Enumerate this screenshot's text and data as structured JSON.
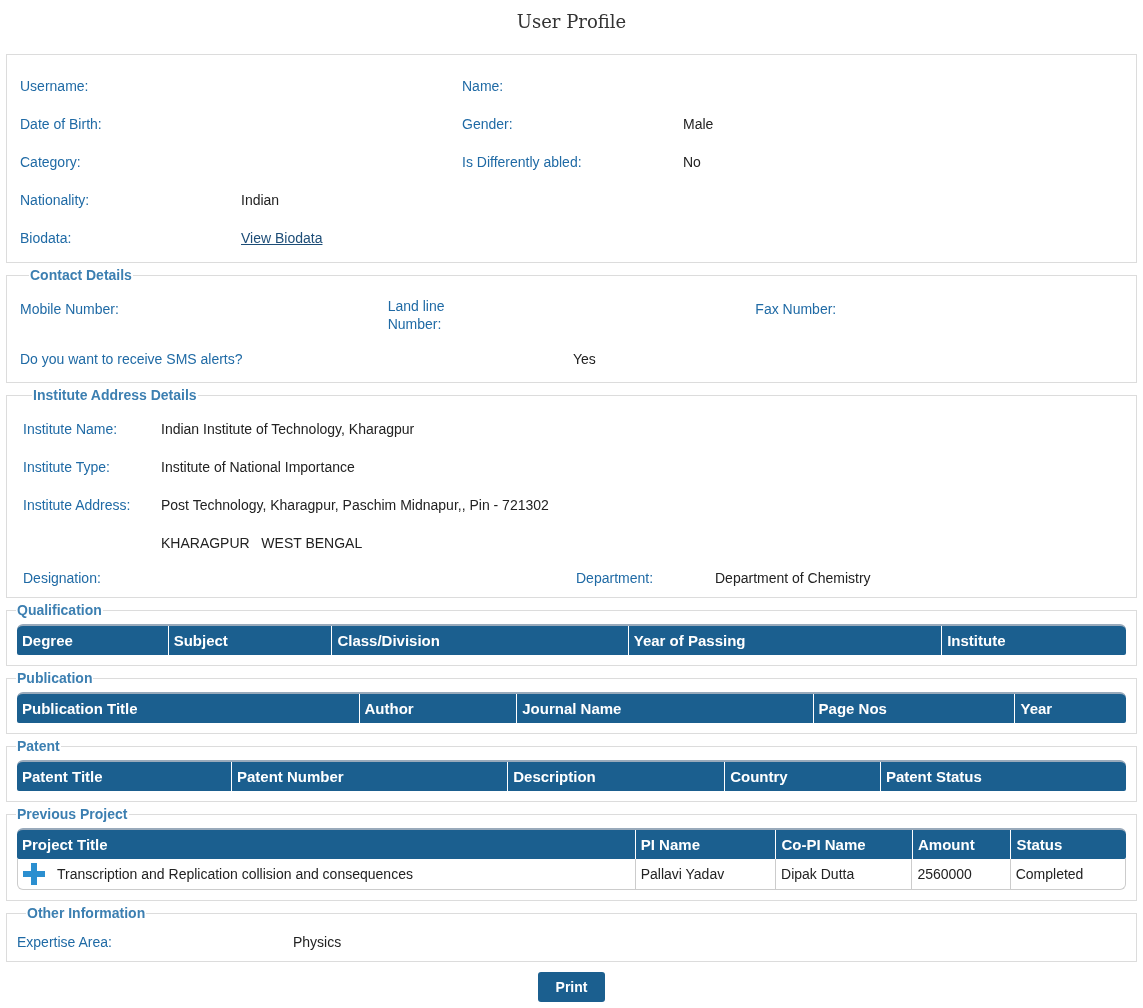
{
  "title": "User Profile",
  "profile": {
    "rows": [
      [
        {
          "label": "Username:"
        },
        {
          "label": "Name:"
        }
      ],
      [
        {
          "label": "Date of Birth:"
        },
        {
          "label": "Gender:",
          "value": "Male",
          "kind": "text"
        }
      ],
      [
        {
          "label": "Category:"
        },
        {
          "label": "Is Differently abled:",
          "value": "No",
          "kind": "text"
        }
      ],
      [
        {
          "label": "Nationality:",
          "value": "Indian",
          "kind": "text"
        }
      ],
      [
        {
          "label": "Biodata:",
          "value": "View Biodata",
          "kind": "link"
        }
      ]
    ]
  },
  "contact": {
    "legend": "Contact Details",
    "fields": [
      {
        "label": "Mobile Number:"
      },
      {
        "label": "Land line Number:"
      },
      {
        "label": "Fax Number:"
      }
    ],
    "sms": {
      "label": "Do you want to receive SMS alerts?",
      "value": "Yes"
    }
  },
  "institute": {
    "legend": "Institute Address Details",
    "rows": [
      {
        "label": "Institute Name:",
        "value": "Indian Institute of Technology, Kharagpur"
      },
      {
        "label": "Institute Type:",
        "value": "Institute of National Importance"
      },
      {
        "label": "Institute Address:",
        "value": "Post Technology, Kharagpur, Paschim Midnapur,, Pin - 721302"
      },
      {
        "value": "KHARAGPUR   WEST BENGAL"
      }
    ],
    "pair": [
      {
        "label": "Designation:"
      },
      {
        "label": "Department:",
        "value": "Department of Chemistry"
      }
    ]
  },
  "tables": [
    {
      "legend": "Qualification",
      "columns": [
        "Degree",
        "Subject",
        "Class/Division",
        "Year of Passing",
        "Institute"
      ]
    },
    {
      "legend": "Publication",
      "columns": [
        "Publication Title",
        "Author",
        "Journal Name",
        "Page Nos",
        "Year"
      ]
    },
    {
      "legend": "Patent",
      "columns": [
        "Patent Title",
        "Patent Number",
        "Description",
        "Country",
        "Patent Status"
      ]
    },
    {
      "legend": "Previous Project",
      "columns": [
        "Project Title",
        "PI Name",
        "Co-PI Name",
        "Amount",
        "Status"
      ],
      "rows": [
        [
          "Transcription and Replication collision and consequences",
          "Pallavi Yadav",
          "Dipak Dutta",
          "2560000",
          "Completed"
        ]
      ]
    }
  ],
  "other": {
    "legend": "Other Information",
    "label": "Expertise Area:",
    "value": "Physics"
  },
  "print_button": "Print"
}
